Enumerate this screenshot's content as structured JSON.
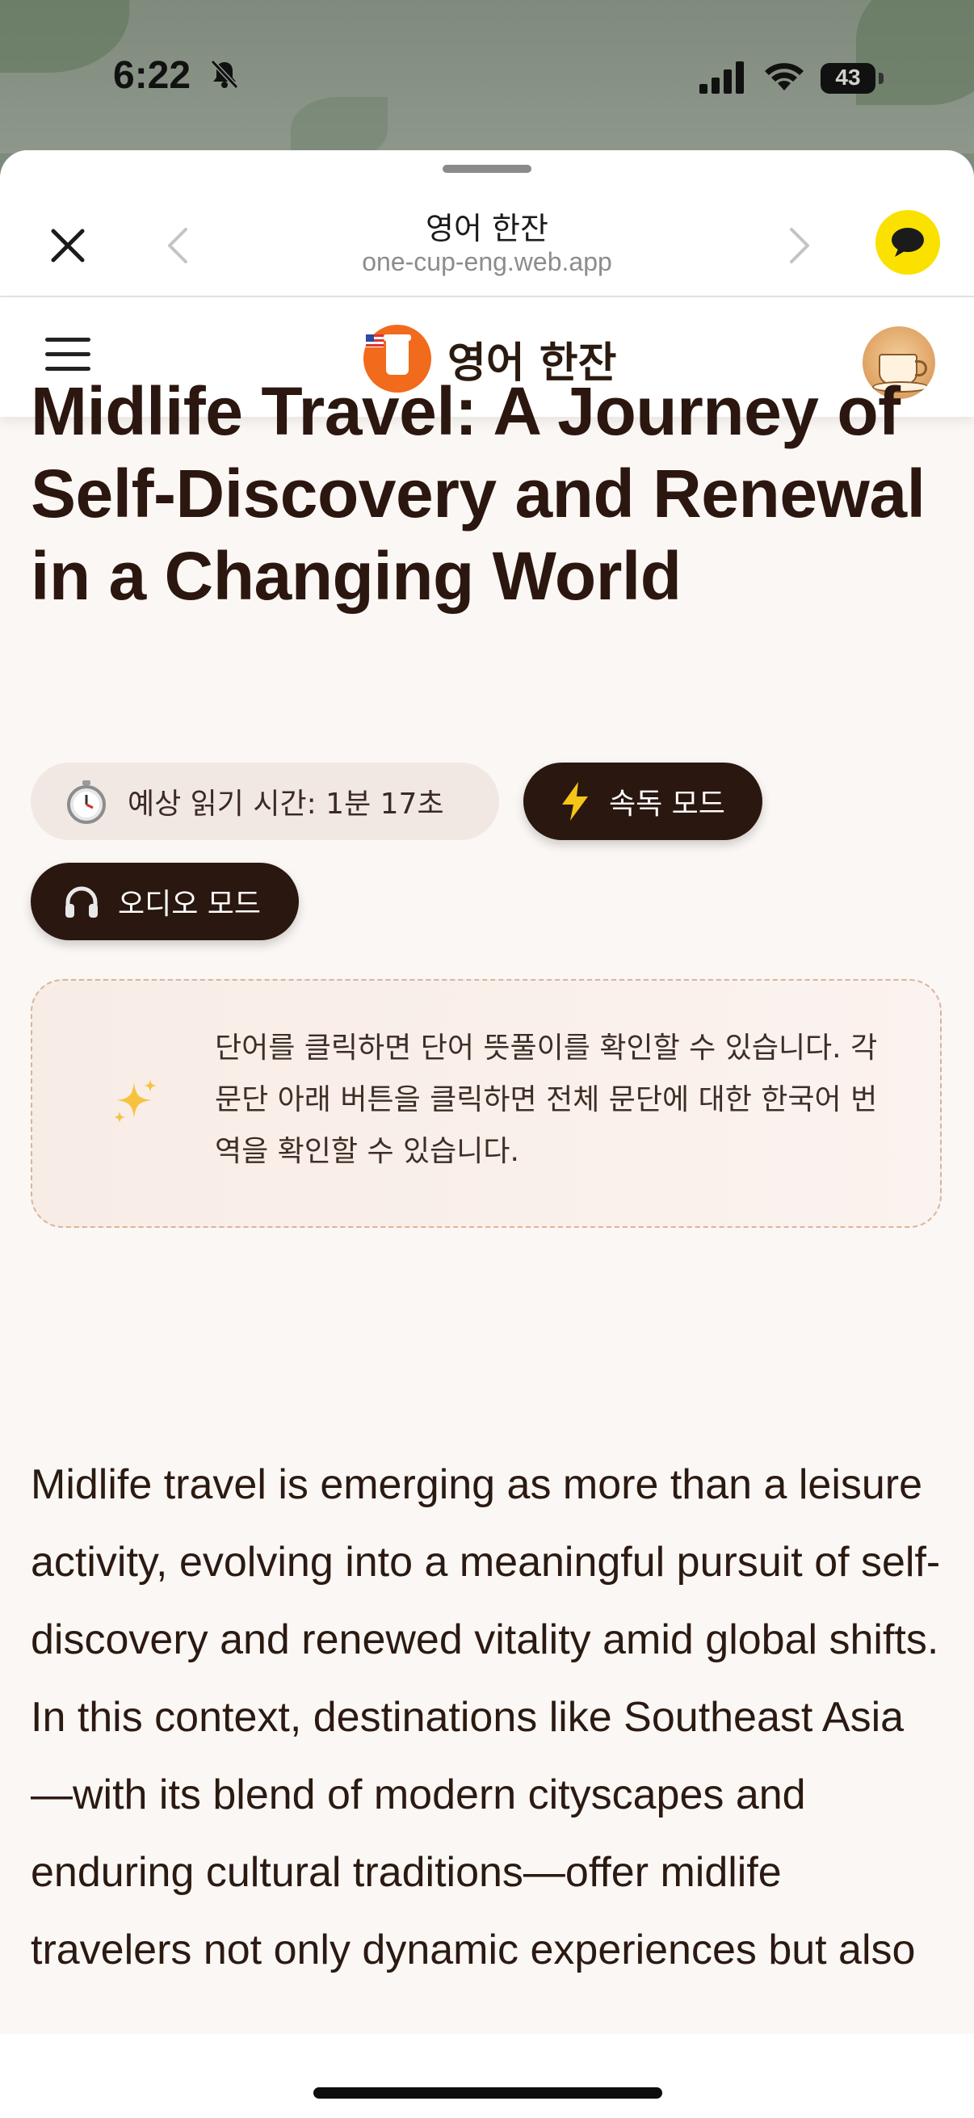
{
  "status_bar": {
    "time": "6:22",
    "battery": "43"
  },
  "browser": {
    "title": "영어 한잔",
    "url": "one-cup-eng.web.app"
  },
  "app_header": {
    "brand_name": "영어 한잔"
  },
  "article": {
    "title": "Midlife Travel: A Journey of Self-Discovery and Renewal in a Changing World",
    "reading_time": "예상 읽기 시간: 1분 17초",
    "speed_mode_label": "속독 모드",
    "audio_mode_label": "오디오 모드",
    "hint": "단어를 클릭하면 단어 뜻풀이를 확인할 수 있습니다. 각 문단 아래 버튼을 클릭하면 전체 문단에 대한 한국어 번역을 확인할 수 있습니다.",
    "paragraph_1": "Midlife travel is emerging as more than a leisure activity, evolving into a meaningful pursuit of self-discovery and renewed vitality amid global shifts. In this context, destinations like Southeast Asia—with its blend of modern cityscapes and enduring cultural traditions—offer midlife travelers not only dynamic experiences but also"
  },
  "colors": {
    "accent_dark": "#2a1710",
    "brand_orange": "#f26a1b",
    "kakao_yellow": "#fae100",
    "page_bg": "#fbf7f4"
  },
  "icons": {
    "close": "close-icon",
    "back": "chevron-left-icon",
    "forward": "chevron-right-icon",
    "chat": "kakao-chat-icon",
    "menu": "hamburger-menu-icon",
    "timer": "stopwatch-icon",
    "speed": "lightning-icon",
    "audio": "headphones-icon",
    "hint": "sparkles-icon"
  }
}
